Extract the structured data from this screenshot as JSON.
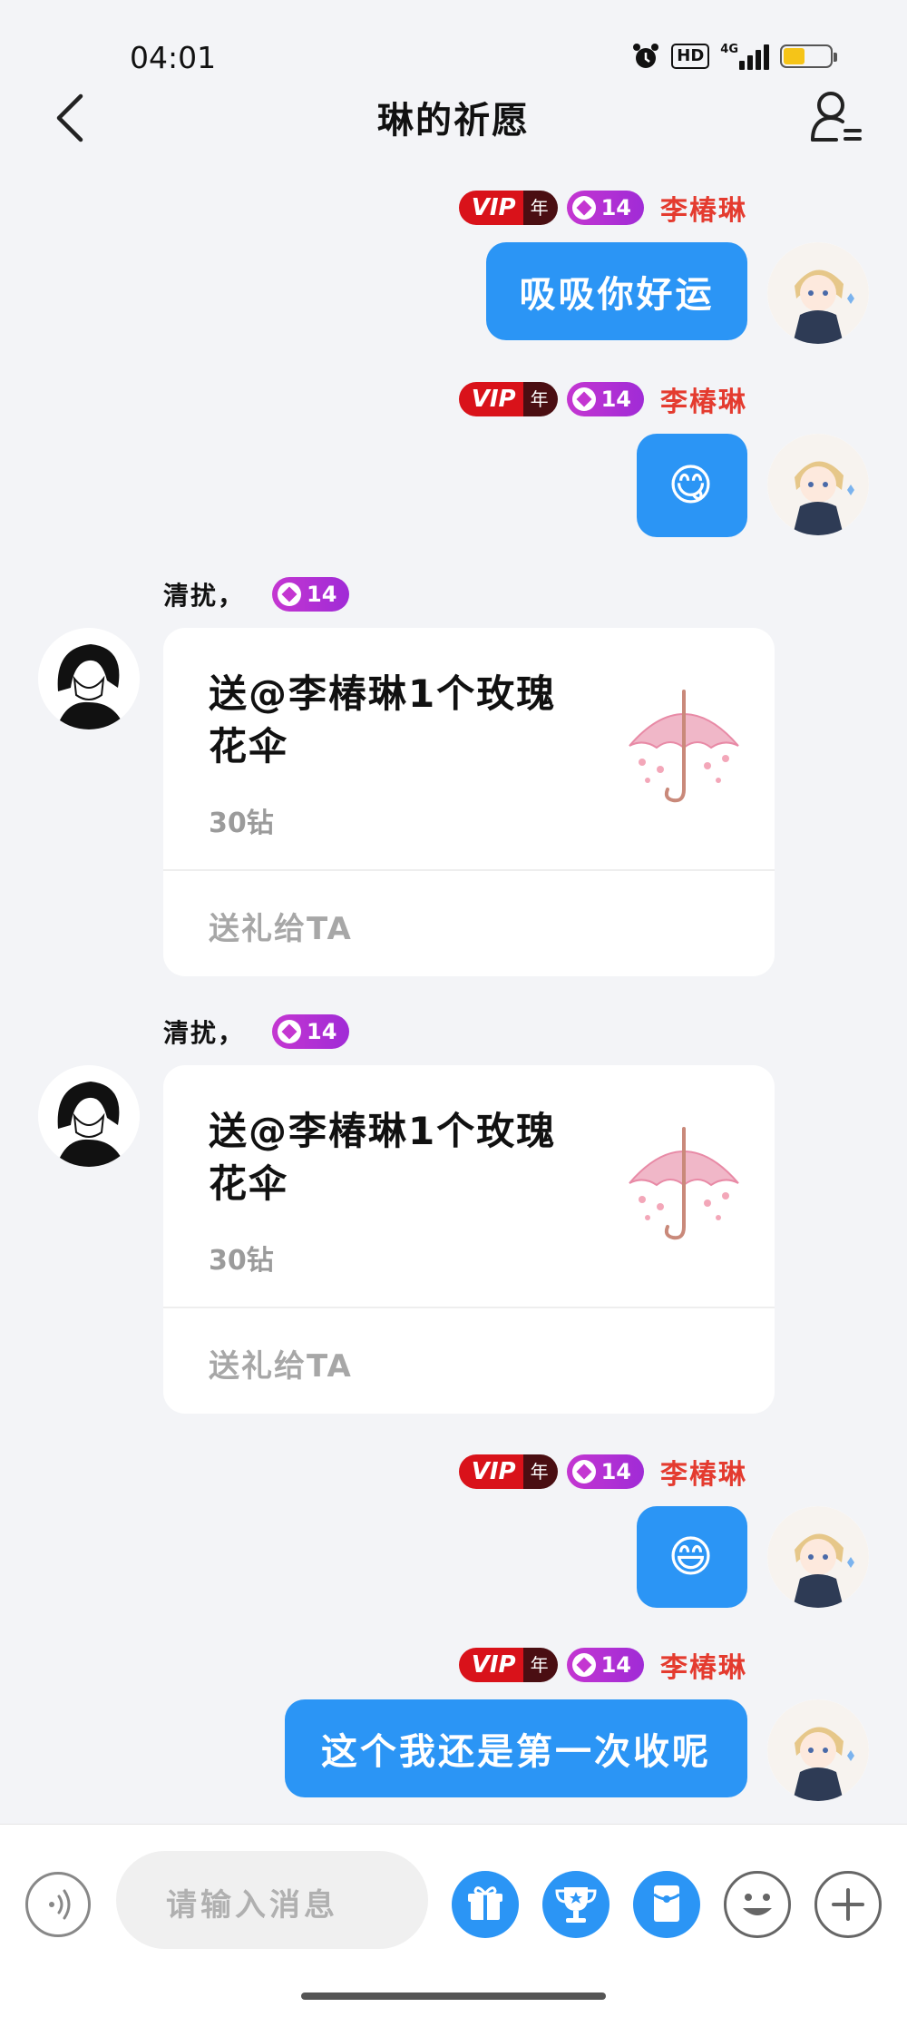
{
  "status_bar": {
    "time": "04:01",
    "hd": "HD",
    "network": "4G"
  },
  "header": {
    "title": "琳的祈愿"
  },
  "badges": {
    "vip": "VIP",
    "vip_year": "年",
    "level": "14"
  },
  "me": {
    "name": "李椿琳"
  },
  "messages": [
    {
      "type": "text",
      "text": "吸吸你好运"
    },
    {
      "type": "emoji",
      "text": "😋"
    },
    {
      "type": "gift",
      "sender": "清扰，",
      "title": "送@李椿琳1个玫瑰花伞",
      "price": "30钻",
      "action": "送礼给TA"
    },
    {
      "type": "gift",
      "sender": "清扰，",
      "title": "送@李椿琳1个玫瑰花伞",
      "price": "30钻",
      "action": "送礼给TA"
    },
    {
      "type": "emoji",
      "text": "😄"
    },
    {
      "type": "text",
      "text": "这个我还是第一次收呢"
    }
  ],
  "composer": {
    "placeholder": "请输入消息"
  },
  "colors": {
    "bubble": "#2b95f5",
    "vip": "#d9121a",
    "level": "#c436d1",
    "name": "#e43b2f"
  },
  "icons": [
    "back-arrow-icon",
    "profile-menu-icon",
    "voice-icon",
    "gift-icon",
    "trophy-icon",
    "red-packet-icon",
    "emoji-icon",
    "plus-icon"
  ]
}
